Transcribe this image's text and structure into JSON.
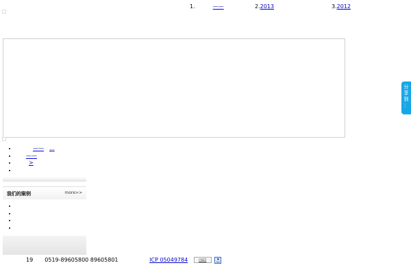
{
  "ticker": {
    "items": [
      {
        "num": "1.",
        "text": "——"
      },
      {
        "num": "2.",
        "text": "2013"
      },
      {
        "num": "3.",
        "text": "2012"
      }
    ]
  },
  "links_top": [
    "——",
    "——",
    ">",
    ""
  ],
  "links_top_prefix": [
    "",
    "",
    "",
    ""
  ],
  "links_top_suffix": [
    "...",
    "",
    "",
    ""
  ],
  "case_panel": {
    "title": "我们的案例",
    "more": "more>>"
  },
  "case_links": [
    "",
    "",
    "",
    ""
  ],
  "footer": {
    "year": "19",
    "phone": "0519-89605800 89605801",
    "link_a": "",
    "link_b": "",
    "icp": "ICP 05049784",
    "badge_cnzz": "CNZZ",
    "badge_police": "⚑"
  },
  "share_tab": {
    "chars": [
      "分",
      "享",
      "到",
      "："
    ]
  }
}
